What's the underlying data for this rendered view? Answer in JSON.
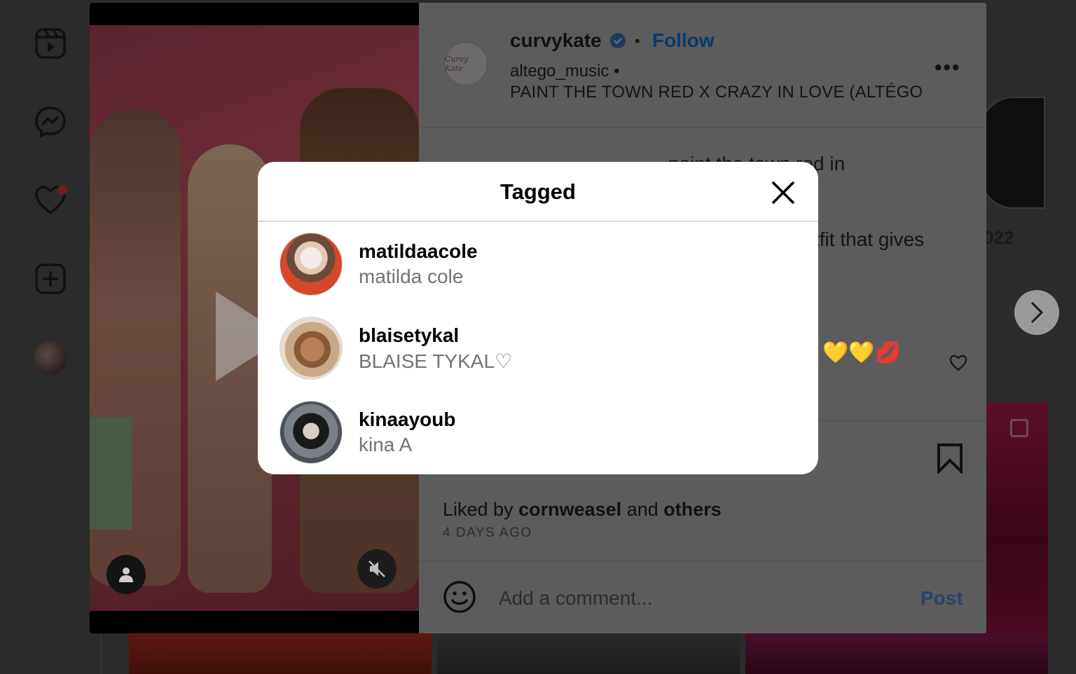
{
  "sidebar": {
    "icons": [
      "reels-icon",
      "messenger-icon",
      "notifications-heart-icon",
      "create-plus-icon",
      "profile-avatar"
    ]
  },
  "post": {
    "username": "curvykate",
    "follow_label": "Follow",
    "audio_user": "altego_music",
    "audio_title": "PAINT THE TOWN RED X CRAZY IN LOVE (ALTÉGO",
    "more_label": "•••",
    "avatar_text": "Curvy Kate",
    "caption_fragment_1": "paint the town red in",
    "caption_fragment_2": "tfit that gives",
    "emojis": "💛💛💋",
    "liked_prefix": "Liked by",
    "liked_user": "cornweasel",
    "liked_and": "and",
    "liked_others": "others",
    "age": "4 DAYS AGO",
    "comment_placeholder": "Add a comment...",
    "post_label": "Post"
  },
  "background": {
    "year_fragment": "022"
  },
  "dialog": {
    "title": "Tagged",
    "users": [
      {
        "username": "matildaacole",
        "name": "matilda cole"
      },
      {
        "username": "blaisetykal",
        "name": "BLAISE TYKAL♡"
      },
      {
        "username": "kinaayoub",
        "name": "kina A"
      }
    ]
  },
  "colors": {
    "accent_blue": "#0095f6",
    "dialog_bg": "#ffffff",
    "secondary_text": "#737373"
  }
}
